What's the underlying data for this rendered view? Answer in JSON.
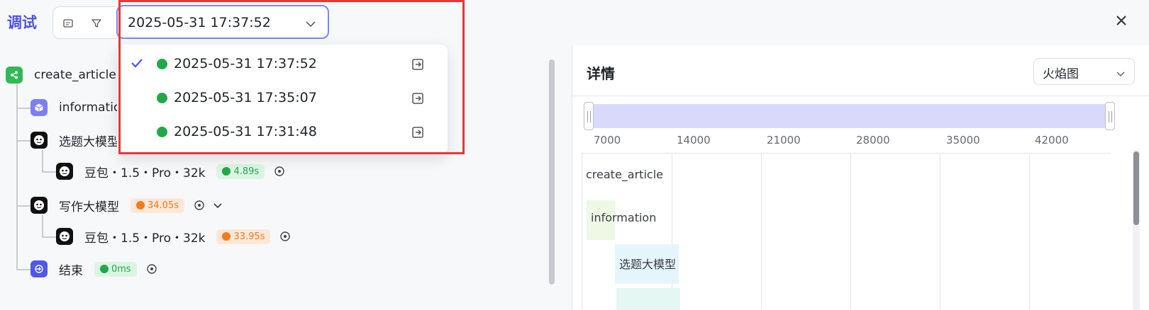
{
  "header": {
    "title": "调试",
    "selected_run": "2025-05-31 17:37:52"
  },
  "run_dropdown": {
    "items": [
      {
        "time": "2025-05-31 17:37:52",
        "selected": true
      },
      {
        "time": "2025-05-31 17:35:07",
        "selected": false
      },
      {
        "time": "2025-05-31 17:31:48",
        "selected": false
      }
    ]
  },
  "tree": {
    "nodes": [
      {
        "label": "create_article",
        "icon": "workflow-icon"
      },
      {
        "label": "informatio",
        "icon": "cube-icon"
      },
      {
        "label": "选题大模型",
        "icon": "llm-avatar-icon"
      },
      {
        "label": "豆包・1.5・Pro・32k",
        "icon": "llm-avatar-icon",
        "badge": "4.89s",
        "status": "success"
      },
      {
        "label": "写作大模型",
        "icon": "llm-avatar-icon",
        "badge": "34.05s",
        "status": "warning"
      },
      {
        "label": "豆包・1.5・Pro・32k",
        "icon": "llm-avatar-icon",
        "badge": "33.95s",
        "status": "warning"
      },
      {
        "label": "结束",
        "icon": "end-icon",
        "badge": "0ms",
        "status": "success"
      }
    ]
  },
  "details": {
    "title": "详情",
    "view_mode": "火焰图",
    "ticks": [
      "7000",
      "14000",
      "21000",
      "28000",
      "35000",
      "42000"
    ],
    "flame": [
      {
        "label": "create_article"
      },
      {
        "label": "information"
      },
      {
        "label": "选题大模型"
      }
    ]
  },
  "colors": {
    "accent": "#4d53e8",
    "success": "#22a84b",
    "warning": "#f07a22",
    "highlight": "#e53935"
  }
}
